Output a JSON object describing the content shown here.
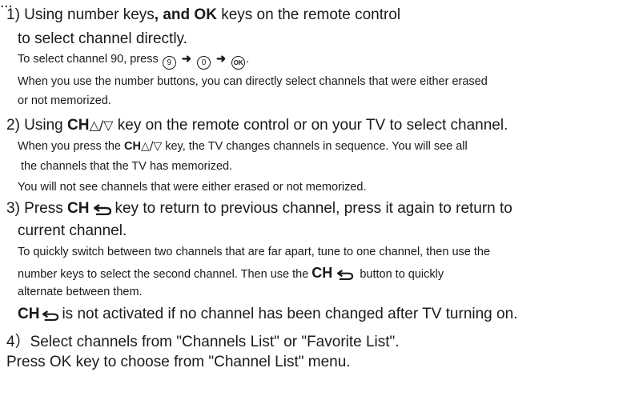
{
  "header_fragment": "   ...",
  "step1": {
    "line1_a": "1) Using number keys",
    "line1_b": ", and ",
    "line1_ok": "OK",
    "line1_c": " keys on the remote control",
    "line2": "to select channel directly.",
    "example_text": "To select channel 90, press ",
    "key_9": "9",
    "key_0": "0",
    "key_ok": "OK",
    "example_end": ".",
    "note_line1": "When you use the number buttons, you can directly select channels that were either erased",
    "note_line2": "or not memorized."
  },
  "step2": {
    "a": "2) Using ",
    "ch": "CH",
    "tri": "△/▽",
    "b": " key on the remote control or on your TV to select channel.",
    "note1_a": "When you press the ",
    "note1_ch": "CH",
    "note1_tri": "△/▽",
    "note1_b": " key, the TV changes channels in sequence. You will see all",
    "note2": "the channels that the TV has memorized.",
    "note3": "You will not see channels that were either erased or not memorized."
  },
  "step3": {
    "a": "3) Press ",
    "ch": "CH",
    "b": "key to return to previous channel, press it again to return to",
    "c": "current channel.",
    "note1": "To quickly switch between two channels that are far apart, tune to one channel, then use the",
    "note2_a": "number keys to select the second channel. Then use the ",
    "note2_ch": "CH",
    "note2_b": " button to quickly",
    "note3": "alternate  between them.",
    "warn_ch": "CH",
    "warn_text": "is not activated if no channel has been changed after TV turning on."
  },
  "step4": {
    "line": "4）Select channels from \"Channels List\" or \"Favorite List\".",
    "footer": "Press OK  key to choose from \"Channel List\" menu."
  },
  "colors": {
    "text": "#1a1a1a",
    "background": "#ffffff"
  }
}
